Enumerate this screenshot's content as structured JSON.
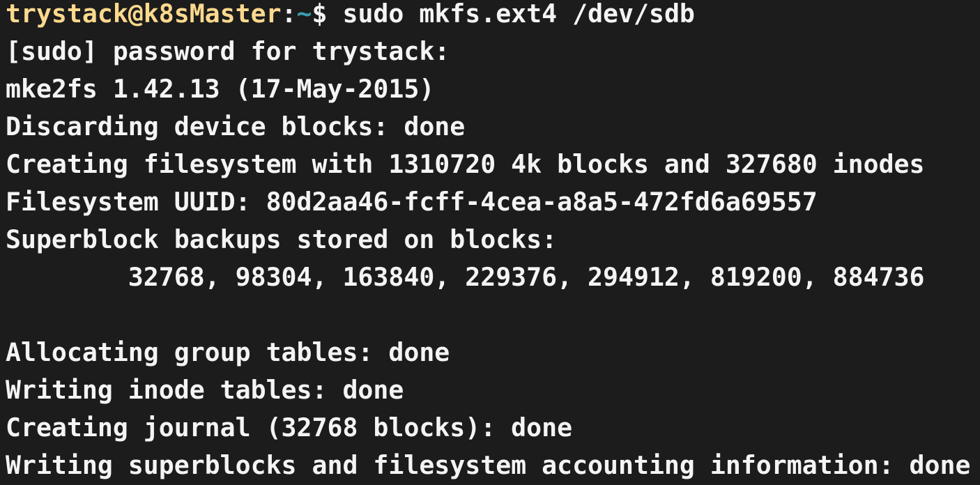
{
  "colors": {
    "background": "#1c1c1c",
    "text": "#f4f4f4",
    "prompt_user_host": "#fdd98e",
    "prompt_path": "#3a9fb0"
  },
  "prompt": {
    "user_host": "trystack@k8sMaster",
    "colon": ":",
    "path": "~",
    "symbol": "$ ",
    "command": "sudo mkfs.ext4 /dev/sdb"
  },
  "output": [
    "[sudo] password for trystack:",
    "mke2fs 1.42.13 (17-May-2015)",
    "Discarding device blocks: done",
    "Creating filesystem with 1310720 4k blocks and 327680 inodes",
    "Filesystem UUID: 80d2aa46-fcff-4cea-a8a5-472fd6a69557",
    "Superblock backups stored on blocks:",
    "        32768, 98304, 163840, 229376, 294912, 819200, 884736",
    "",
    "Allocating group tables: done",
    "Writing inode tables: done",
    "Creating journal (32768 blocks): done",
    "Writing superblocks and filesystem accounting information: done"
  ]
}
